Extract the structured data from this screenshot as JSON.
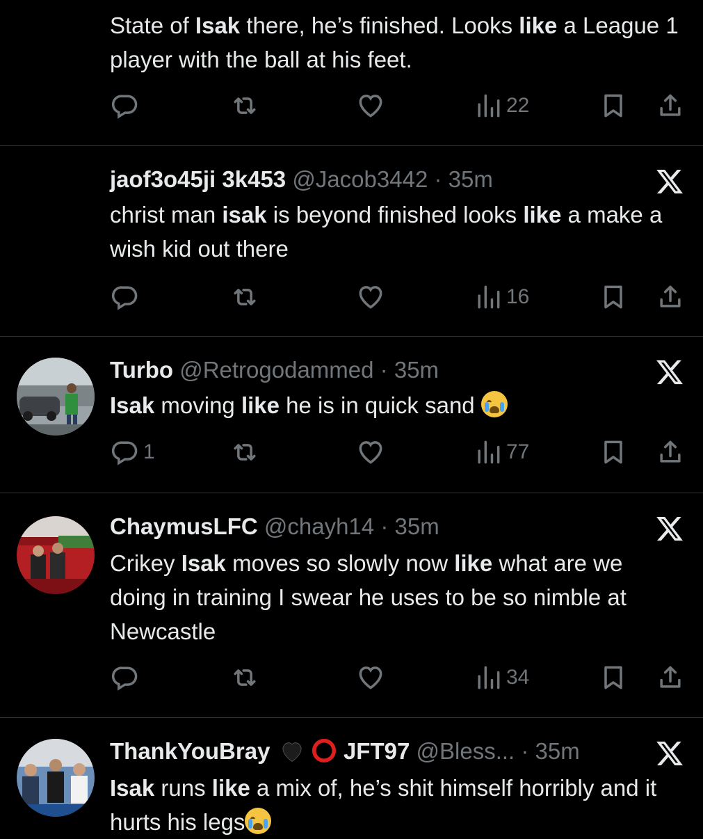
{
  "tweets": [
    {
      "name": "",
      "handle": "",
      "time": "",
      "text_parts": [
        {
          "t": "State of ",
          "b": false
        },
        {
          "t": "Isak",
          "b": true
        },
        {
          "t": " there, he’s finished. Looks ",
          "b": false
        },
        {
          "t": "like",
          "b": true
        },
        {
          "t": " a League 1 player with the ball at  his feet.",
          "b": false
        }
      ],
      "replies": "",
      "views": "22"
    },
    {
      "name": "jaof3o45ji 3k453",
      "handle": "@Jacob3442",
      "time": "35m",
      "text_parts": [
        {
          "t": "christ man ",
          "b": false
        },
        {
          "t": "isak",
          "b": true
        },
        {
          "t": " is beyond finished looks ",
          "b": false
        },
        {
          "t": "like",
          "b": true
        },
        {
          "t": " a make a wish kid out there",
          "b": false
        }
      ],
      "replies": "",
      "views": "16"
    },
    {
      "name": "Turbo",
      "handle": "@Retrogodammed",
      "time": "35m",
      "text_parts": [
        {
          "t": "Isak",
          "b": true
        },
        {
          "t": " moving ",
          "b": false
        },
        {
          "t": "like",
          "b": true
        },
        {
          "t": " he is in quick sand ",
          "b": false
        }
      ],
      "replies": "1",
      "views": "77"
    },
    {
      "name": "ChaymusLFC",
      "handle": "@chayh14",
      "time": "35m",
      "text_parts": [
        {
          "t": "Crikey ",
          "b": false
        },
        {
          "t": "Isak",
          "b": true
        },
        {
          "t": " moves so slowly now ",
          "b": false
        },
        {
          "t": "like",
          "b": true
        },
        {
          "t": " what are we doing in training I swear he uses to be so nimble at Newcastle",
          "b": false
        }
      ],
      "replies": "",
      "views": "34"
    },
    {
      "name": "ThankYouBray",
      "name_suffix": "JFT97",
      "handle": "@Bless...",
      "time": "35m",
      "text_parts": [
        {
          "t": "Isak",
          "b": true
        },
        {
          "t": " runs ",
          "b": false
        },
        {
          "t": "like",
          "b": true
        },
        {
          "t": " a mix of, he’s shit himself horribly and it hurts his legs",
          "b": false
        }
      ],
      "replies": "",
      "views": ""
    }
  ],
  "separator": "·",
  "colors": {
    "background": "#000000",
    "text": "#e7e9ea",
    "muted": "#71767b",
    "divider": "#2f3336"
  },
  "icons": [
    "reply-icon",
    "retweet-icon",
    "like-icon",
    "views-icon",
    "bookmark-icon",
    "share-icon",
    "x-logo-icon",
    "crying-emoji-icon",
    "black-heart-icon",
    "red-circle-icon"
  ]
}
